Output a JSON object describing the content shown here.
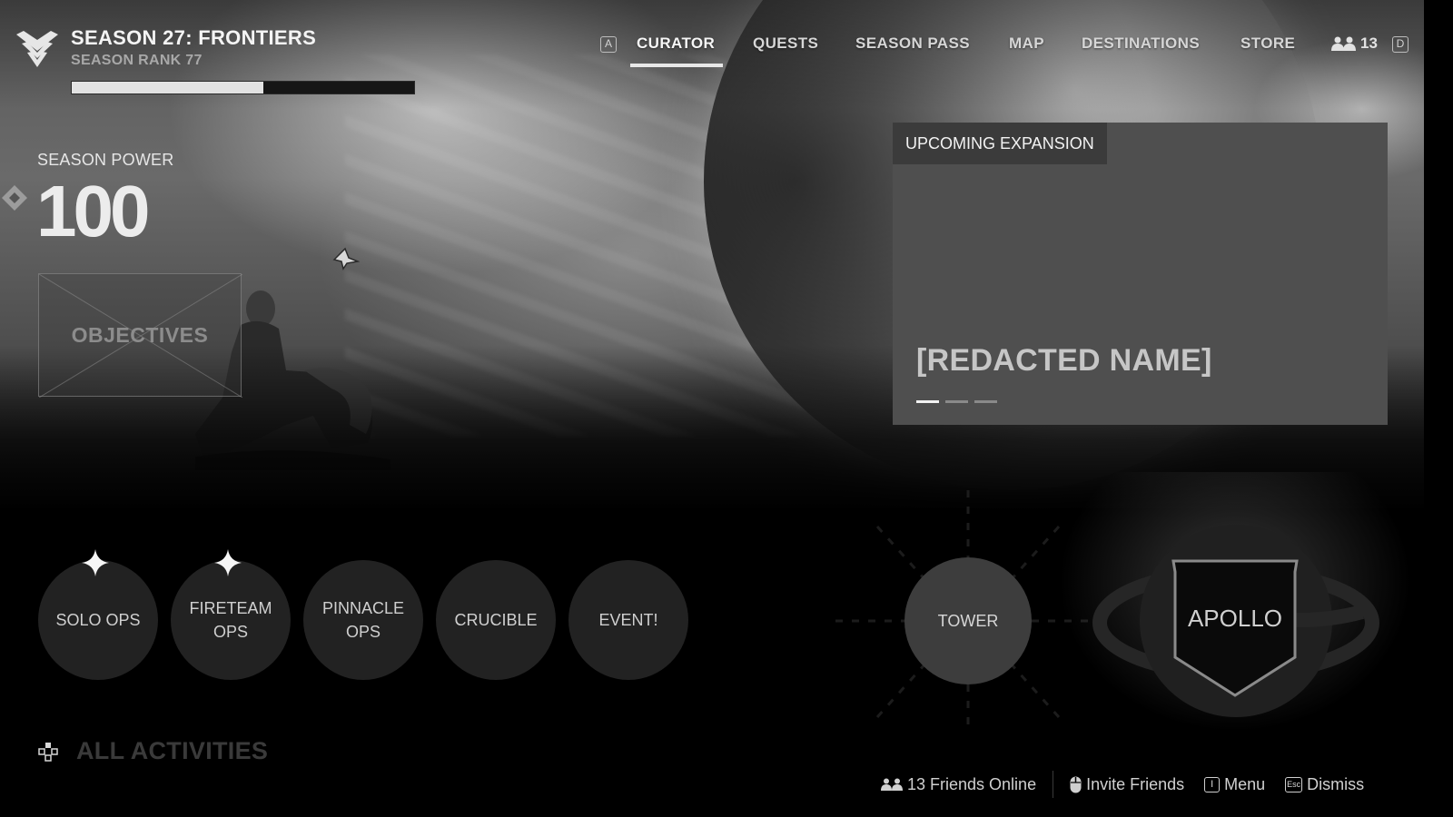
{
  "season": {
    "title": "SEASON 27: FRONTIERS",
    "rank_label": "SEASON RANK 77",
    "rank_progress": 0.56
  },
  "nav": {
    "left_key": "A",
    "right_key": "D",
    "tabs": [
      {
        "label": "CURATOR",
        "active": true
      },
      {
        "label": "QUESTS",
        "active": false
      },
      {
        "label": "SEASON PASS",
        "active": false
      },
      {
        "label": "MAP",
        "active": false
      },
      {
        "label": "DESTINATIONS",
        "active": false
      },
      {
        "label": "STORE",
        "active": false
      }
    ],
    "friends_count": "13",
    "friends_icon": "people-icon"
  },
  "power": {
    "label": "SEASON POWER",
    "value": "100",
    "icon": "power-diamond-icon"
  },
  "objectives": {
    "label": "OBJECTIVES"
  },
  "expansion": {
    "tag": "UPCOMING EXPANSION",
    "name": "[REDACTED NAME]",
    "slides": 3,
    "active_slide": 0
  },
  "activities": [
    {
      "label": "SOLO OPS",
      "badge": "sparkle-icon"
    },
    {
      "label": "FIRETEAM\nOPS",
      "badge": "sparkle-icon"
    },
    {
      "label": "PINNACLE\nOPS",
      "badge": null
    },
    {
      "label": "CRUCIBLE",
      "badge": null
    },
    {
      "label": "EVENT!",
      "badge": null
    }
  ],
  "destinations": {
    "tower": "TOWER",
    "apollo": "APOLLO"
  },
  "all_activities": {
    "label": "ALL ACTIVITIES",
    "icon": "dpad-icon"
  },
  "footer": {
    "friends_online": "13 Friends Online",
    "invite": "Invite Friends",
    "invite_icon": "mouse-icon",
    "menu": "Menu",
    "menu_key": "I",
    "dismiss": "Dismiss",
    "dismiss_key": "Esc"
  }
}
